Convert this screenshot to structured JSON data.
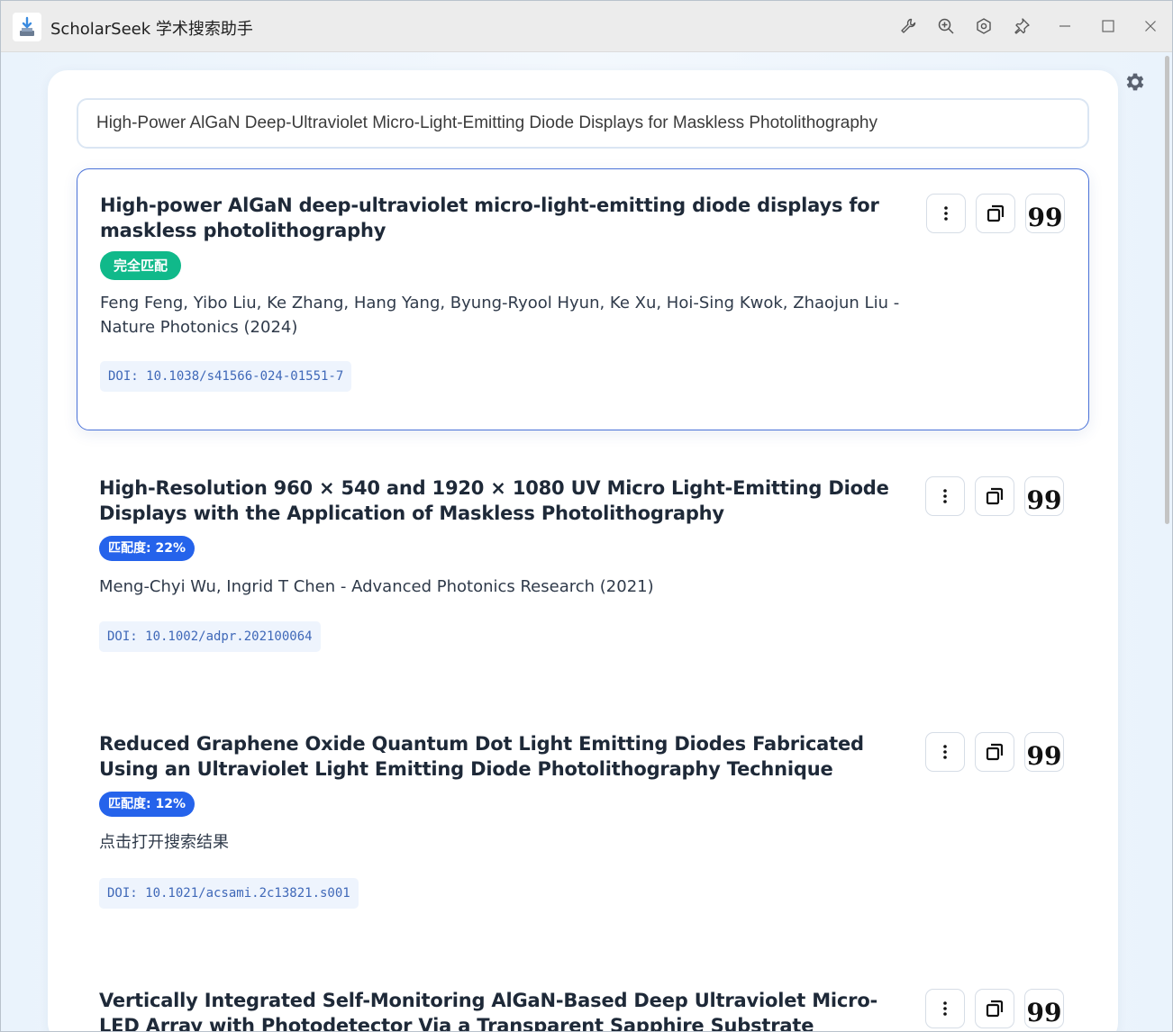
{
  "window": {
    "title": "ScholarSeek 学术搜索助手"
  },
  "search": {
    "value": "High-Power AlGaN Deep-Ultraviolet Micro-Light-Emitting Diode Displays for Maskless Photolithography"
  },
  "results": [
    {
      "title": "High-power AlGaN deep-ultraviolet micro-light-emitting diode displays for maskless photolithography",
      "badge": "完全匹配",
      "badge_color": "#10b98a",
      "authors": "Feng Feng, Yibo Liu, Ke Zhang, Hang Yang, Byung-Ryool Hyun, Ke Xu, Hoi-Sing Kwok, Zhaojun Liu - Nature Photonics (2024)",
      "doi": "DOI: 10.1038/s41566-024-01551-7",
      "selected": true
    },
    {
      "title": "High-Resolution 960 × 540 and 1920 × 1080 UV Micro Light-Emitting Diode Displays with the Application of Maskless Photolithography",
      "badge": "匹配度: 22%",
      "badge_color": "#2563eb",
      "authors": "Meng-Chyi Wu, Ingrid T Chen - Advanced Photonics Research (2021)",
      "doi": "DOI: 10.1002/adpr.202100064"
    },
    {
      "title": "Reduced Graphene Oxide Quantum Dot Light Emitting Diodes Fabricated Using an Ultraviolet Light Emitting Diode Photolithography Technique",
      "badge": "匹配度: 12%",
      "badge_color": "#2563eb",
      "authors": "点击打开搜索结果",
      "doi": "DOI: 10.1021/acsami.2c13821.s001"
    },
    {
      "title": "Vertically Integrated Self-Monitoring AlGaN-Based Deep Ultraviolet Micro-LED Array with Photodetector Via a Transparent Sapphire Substrate Toward Stable and Compact"
    }
  ],
  "icons": {
    "titlebar": [
      "wrench-icon",
      "zoom-in-icon",
      "hexagon-settings-icon",
      "pin-icon",
      "minimize-icon",
      "maximize-icon",
      "close-icon"
    ],
    "card_actions": [
      "more-vertical-icon",
      "copy-icon",
      "quote-icon"
    ],
    "settings": "gear-icon"
  },
  "colors": {
    "accent": "#2563eb",
    "match_green": "#10b98a",
    "selected_border": "#4a72d8"
  }
}
